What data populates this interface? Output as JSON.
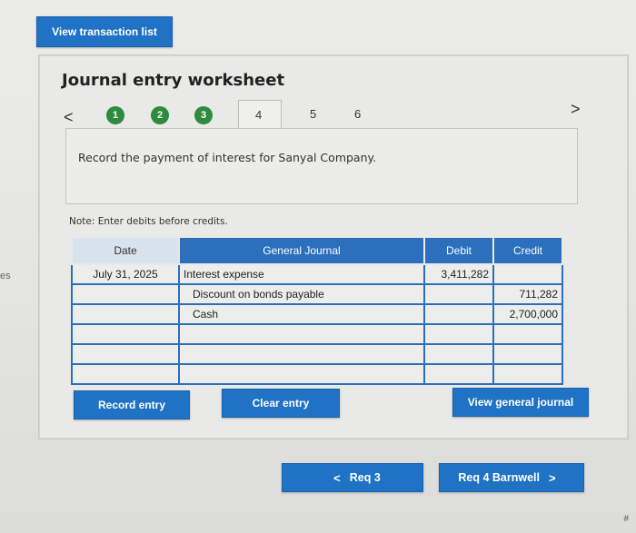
{
  "header": {
    "view_transaction_list": "View transaction list"
  },
  "edge_text": "es",
  "worksheet": {
    "title": "Journal entry worksheet",
    "nav": {
      "prev": "<",
      "next": ">"
    },
    "steps": [
      {
        "label": "1",
        "completed": true
      },
      {
        "label": "2",
        "completed": true
      },
      {
        "label": "3",
        "completed": true
      },
      {
        "label": "4",
        "completed": false,
        "active": true
      },
      {
        "label": "5",
        "completed": false
      },
      {
        "label": "6",
        "completed": false
      }
    ],
    "prompt": "Record the payment of interest for Sanyal Company.",
    "note": "Note: Enter debits before credits.",
    "table": {
      "headers": {
        "date": "Date",
        "account": "General Journal",
        "debit": "Debit",
        "credit": "Credit"
      },
      "rows": [
        {
          "date": "July 31, 2025",
          "account": "Interest expense",
          "debit": "3,411,282",
          "credit": ""
        },
        {
          "date": "",
          "account": "Discount on bonds payable",
          "debit": "",
          "credit": "711,282"
        },
        {
          "date": "",
          "account": "Cash",
          "debit": "",
          "credit": "2,700,000"
        },
        {
          "date": "",
          "account": "",
          "debit": "",
          "credit": ""
        },
        {
          "date": "",
          "account": "",
          "debit": "",
          "credit": ""
        },
        {
          "date": "",
          "account": "",
          "debit": "",
          "credit": ""
        }
      ]
    },
    "buttons": {
      "record_entry": "Record entry",
      "clear_entry": "Clear entry",
      "view_general_journal": "View general journal"
    }
  },
  "footer_nav": {
    "prev_label": "Req 3",
    "next_label": "Req 4 Barnwell",
    "prev_icon": "<",
    "next_icon": ">"
  },
  "corner_mark": "#",
  "colors": {
    "primary_blue": "#1f72c4",
    "step_green": "#2e8b3c"
  }
}
